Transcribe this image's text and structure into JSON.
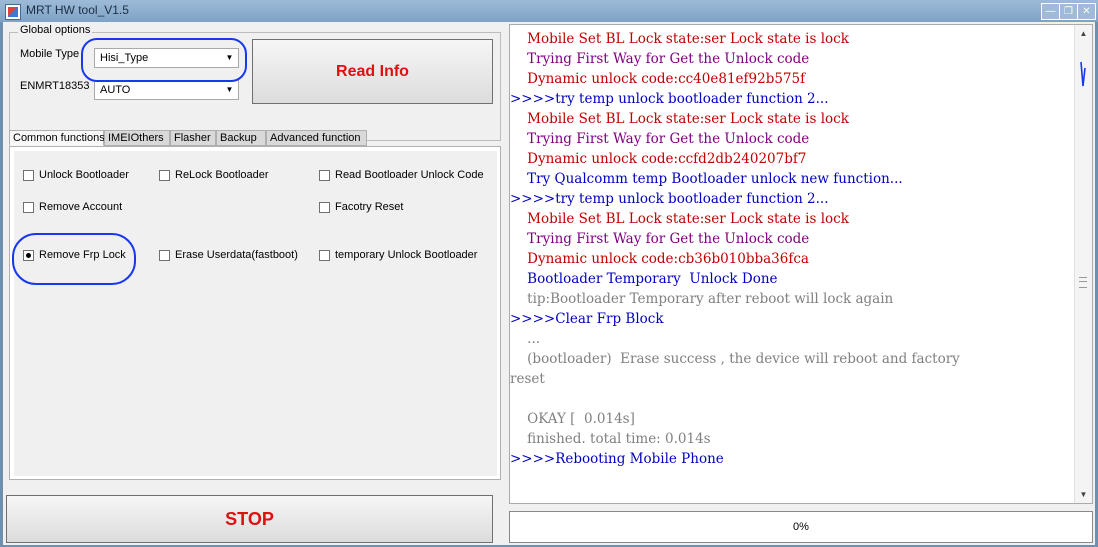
{
  "window": {
    "title": "MRT HW tool_V1.5"
  },
  "global_options": {
    "legend": "Global options",
    "mobile_type_label": "Mobile Type",
    "mobile_type_value": "Hisi_Type",
    "enmrt_label": "ENMRT18353",
    "enmrt_value": "AUTO",
    "read_info_label": "Read Info"
  },
  "tabs": [
    {
      "label": "Common functions",
      "active": true
    },
    {
      "label": "IMEIOthers",
      "active": false
    },
    {
      "label": "Flasher",
      "active": false
    },
    {
      "label": "Backup",
      "active": false
    },
    {
      "label": "Advanced function",
      "active": false
    }
  ],
  "options": {
    "unlock_bootloader": "Unlock Bootloader",
    "relock_bootloader": "ReLock Bootloader",
    "read_bl_unlock_code": "Read Bootloader Unlock Code",
    "remove_account": "Remove Account",
    "factory_reset": "Facotry Reset",
    "remove_frp_lock": "Remove Frp Lock",
    "erase_userdata": "Erase Userdata(fastboot)",
    "temp_unlock_bl": "temporary Unlock Bootloader"
  },
  "stop_label": "STOP",
  "console_lines": [
    {
      "text": "    Mobile Set BL Lock state:ser Lock state is lock",
      "color": "red"
    },
    {
      "text": "    Trying First Way for Get the Unlock code",
      "color": "purple"
    },
    {
      "text": "    Dynamic unlock code:cc40e81ef92b575f",
      "color": "red"
    },
    {
      "text": ">>>>try temp unlock bootloader function 2...",
      "color": "blue"
    },
    {
      "text": "    Mobile Set BL Lock state:ser Lock state is lock",
      "color": "red"
    },
    {
      "text": "    Trying First Way for Get the Unlock code",
      "color": "purple"
    },
    {
      "text": "    Dynamic unlock code:ccfd2db240207bf7",
      "color": "red"
    },
    {
      "text": "    Try Qualcomm temp Bootloader unlock new function...",
      "color": "blue"
    },
    {
      "text": ">>>>try temp unlock bootloader function 2...",
      "color": "blue"
    },
    {
      "text": "    Mobile Set BL Lock state:ser Lock state is lock",
      "color": "red"
    },
    {
      "text": "    Trying First Way for Get the Unlock code",
      "color": "purple"
    },
    {
      "text": "    Dynamic unlock code:cb36b010bba36fca",
      "color": "red"
    },
    {
      "text": "    Bootloader Temporary  Unlock Done",
      "color": "blue"
    },
    {
      "text": "    tip:Bootloader Temporary after reboot will lock again",
      "color": "gray"
    },
    {
      "text": ">>>>Clear Frp Block",
      "color": "blue"
    },
    {
      "text": "    ...",
      "color": "gray"
    },
    {
      "text": "    (bootloader)  Erase success , the device will reboot and factory",
      "color": "gray"
    },
    {
      "text": "reset",
      "color": "gray"
    },
    {
      "text": "",
      "color": "gray"
    },
    {
      "text": "    OKAY [  0.014s]",
      "color": "gray"
    },
    {
      "text": "    finished. total time: 0.014s",
      "color": "gray"
    },
    {
      "text": ">>>>Rebooting Mobile Phone",
      "color": "blue"
    }
  ],
  "progress": {
    "value": 0,
    "label": "0%"
  },
  "colors": {
    "red": "#c00000",
    "purple": "#800080",
    "blue": "#0000c0",
    "gray": "#808080",
    "annotation": "#1838ee"
  },
  "icons": {
    "app": "app-logo-icon",
    "minimize": "minimize-icon",
    "restore": "restore-icon",
    "close": "close-icon"
  }
}
